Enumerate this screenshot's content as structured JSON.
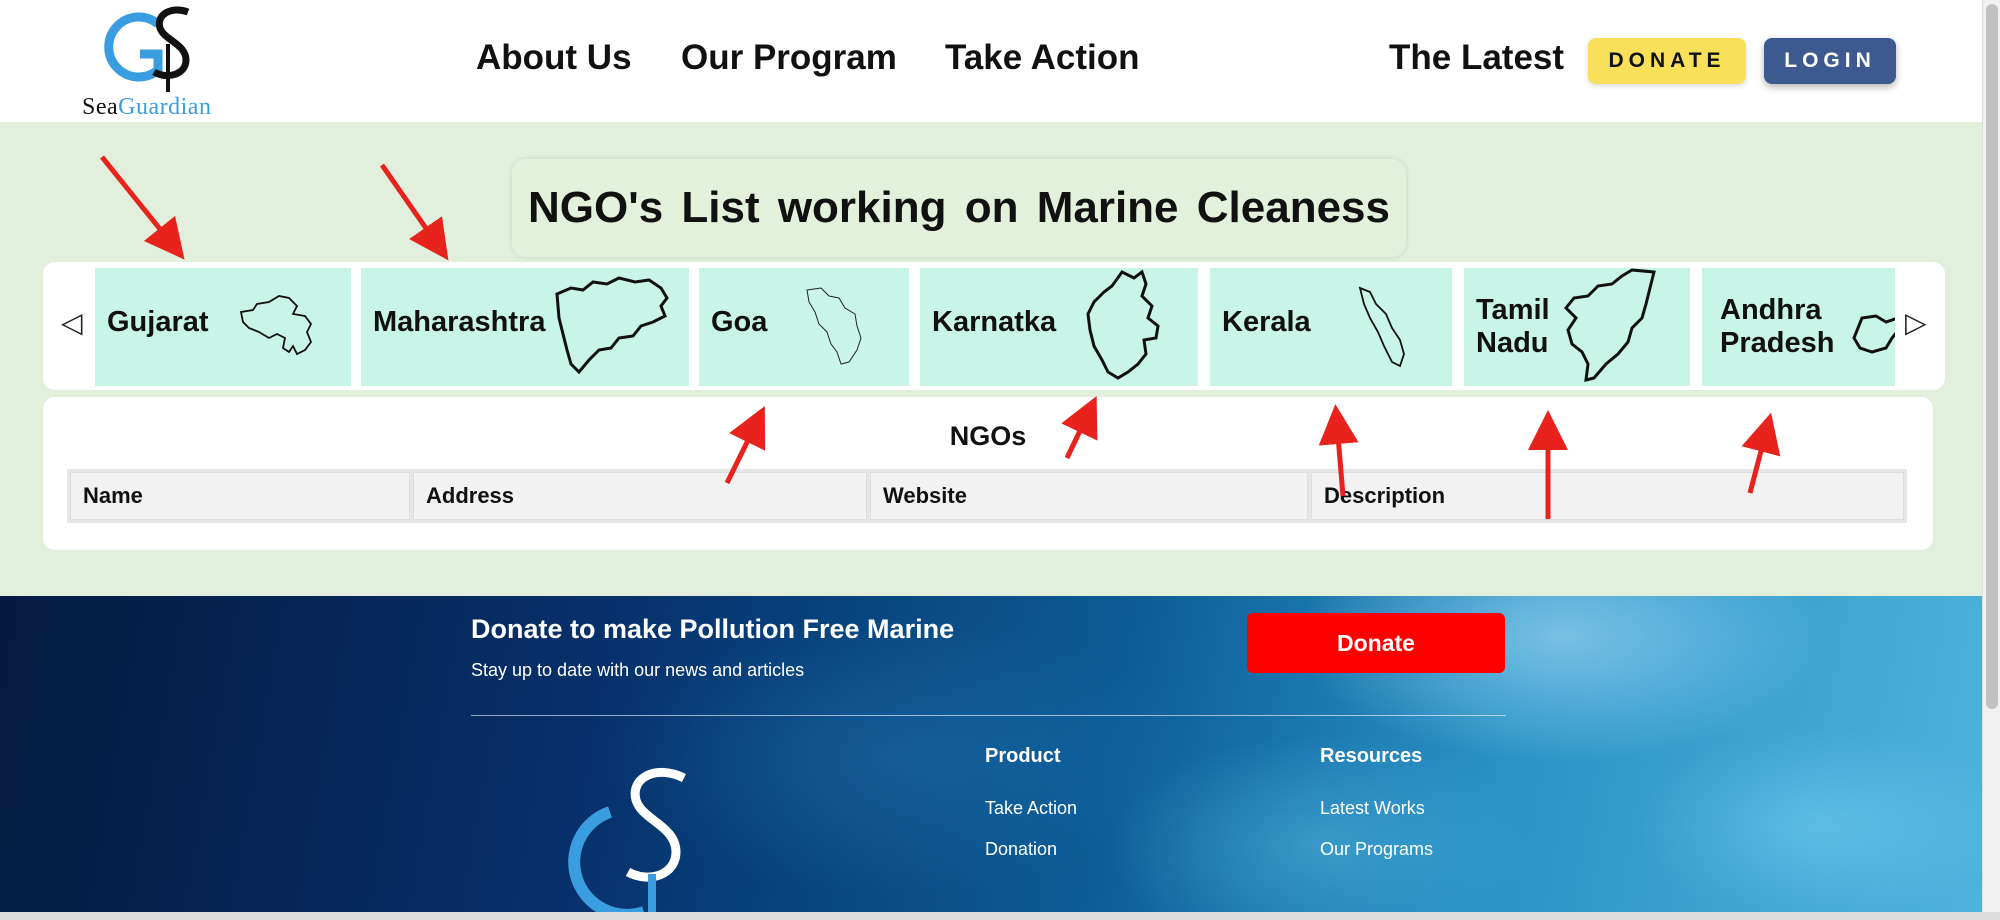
{
  "header": {
    "logo_word_left": "Sea",
    "logo_word_right": "Guardian",
    "nav": [
      "About Us",
      "Our Program",
      "Take Action",
      "The Latest"
    ],
    "donate_label": "DONATE",
    "login_label": "LOGIN"
  },
  "main": {
    "title": "NGO's List working on Marine Cleaness",
    "prev_arrow": "◁",
    "next_arrow": "▷",
    "states": [
      "Gujarat",
      "Maharashtra",
      "Goa",
      "Karnatka",
      "Kerala",
      "Tamil\nNadu",
      "Andhra\nPradesh"
    ],
    "ngo_title": "NGOs",
    "table_headers": [
      "Name",
      "Address",
      "Website",
      "Description"
    ]
  },
  "footer": {
    "heading": "Donate to make Pollution Free Marine",
    "subtext": "Stay up to date with our news and articles",
    "donate_label": "Donate",
    "product_title": "Product",
    "product_links": [
      "Take Action",
      "Donation"
    ],
    "resources_title": "Resources",
    "resources_links": [
      "Latest Works",
      "Our Programs"
    ]
  },
  "colors": {
    "main_bg": "#e3efdd",
    "card_bg": "#c9f5e8",
    "donate_yellow": "#f9e05a",
    "login_blue": "#3c5a8f",
    "footer_donate_red": "#ff0000",
    "annotation_red": "#e8221c",
    "logo_blue": "#3a9de0"
  }
}
